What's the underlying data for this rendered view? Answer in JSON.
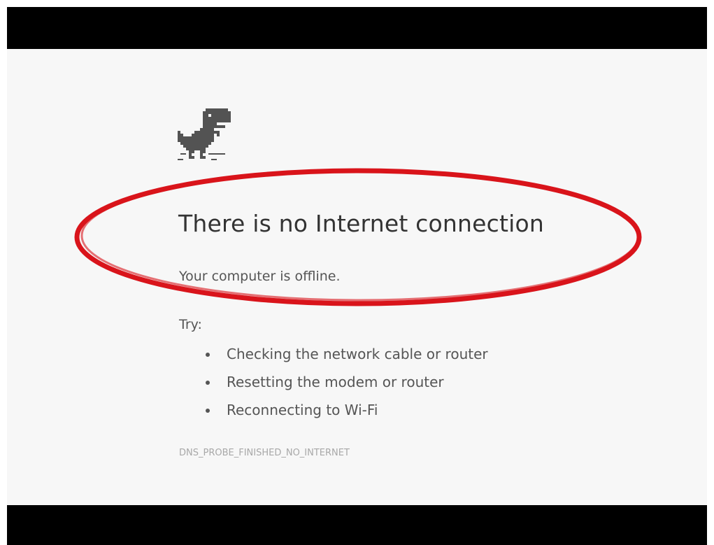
{
  "error_page": {
    "icon": "dinosaur-offline-icon",
    "headline": "There is no Internet connection",
    "subtitle": "Your computer is offline.",
    "try_label": "Try:",
    "suggestions": [
      "Checking the network cable or router",
      "Resetting the modem or router",
      "Reconnecting to Wi-Fi"
    ],
    "error_code": "DNS_PROBE_FINISHED_NO_INTERNET"
  },
  "annotation": {
    "shape": "ellipse",
    "color": "#d9141b"
  },
  "colors": {
    "page_background": "#f7f7f7",
    "letterbox": "#000000",
    "headline_text": "#333333",
    "body_text": "#555555",
    "error_code_text": "#a8a8a8",
    "dino": "#535353"
  }
}
